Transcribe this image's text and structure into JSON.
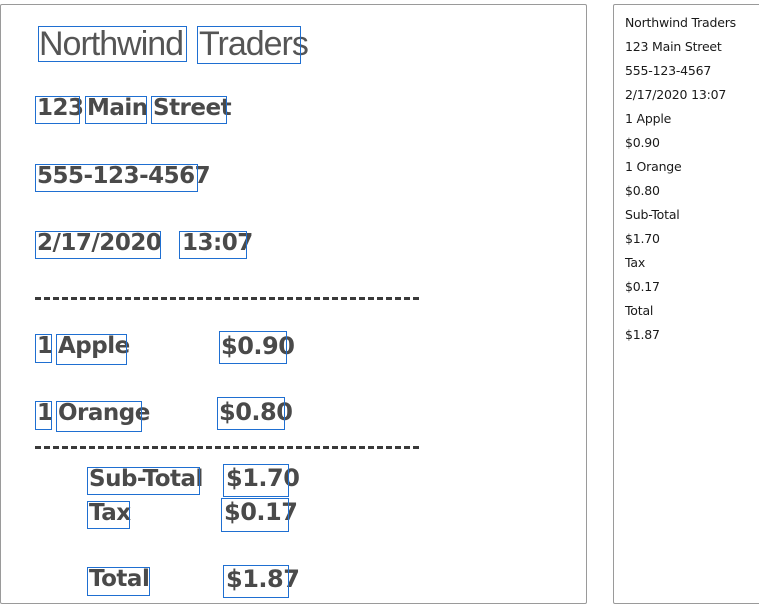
{
  "receipt": {
    "title_words": [
      "Northwind",
      "Traders"
    ],
    "address_words": [
      "123",
      "Main",
      "Street"
    ],
    "phone": "555-123-4567",
    "date": "2/17/2020",
    "time": "13:07",
    "item1": {
      "qty": "1",
      "name": "Apple",
      "price": "$0.90"
    },
    "item2": {
      "qty": "1",
      "name": "Orange",
      "price": "$0.80"
    },
    "subtotal": {
      "label": "Sub-Total",
      "value": "$1.70"
    },
    "tax": {
      "label": "Tax",
      "value": "$0.17"
    },
    "total": {
      "label": "Total",
      "value": "$1.87"
    }
  },
  "ocr_results": [
    "Northwind Traders",
    "123 Main Street",
    "555-123-4567",
    "2/17/2020 13:07",
    "1 Apple",
    "$0.90",
    "1 Orange",
    "$0.80",
    "Sub-Total",
    "$1.70",
    "Tax",
    "$0.17",
    "Total",
    "$1.87"
  ],
  "colors": {
    "highlight_box": "#1f6fd1",
    "receipt_text": "#4a4a4a"
  }
}
